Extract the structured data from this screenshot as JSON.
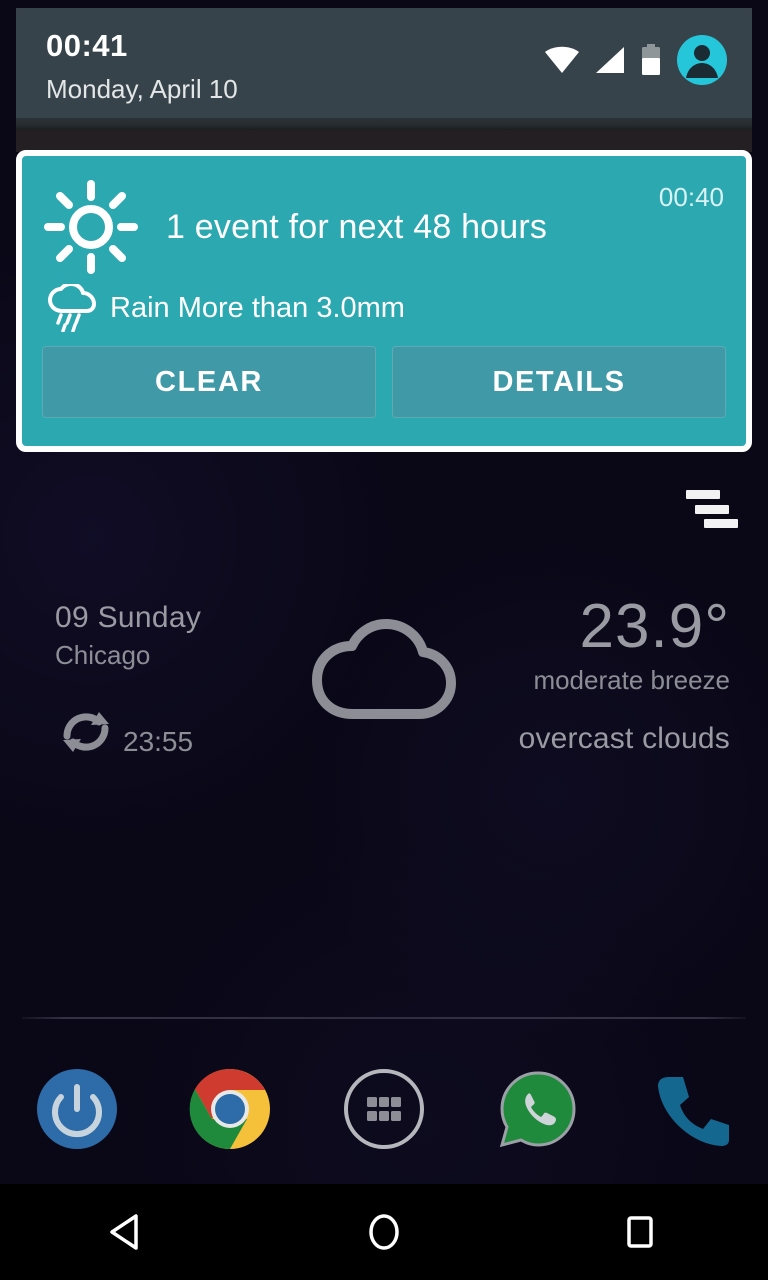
{
  "status_bar": {
    "clock": "00:41",
    "date": "Monday, April 10",
    "icons": [
      {
        "name": "wifi-icon",
        "label": "wifi"
      },
      {
        "name": "cellular-signal-icon",
        "label": "cellular"
      },
      {
        "name": "battery-icon",
        "label": "battery"
      },
      {
        "name": "user-avatar-icon",
        "label": "user"
      }
    ],
    "accent_color": "#26c6da",
    "background_color": "#37434a"
  },
  "notification": {
    "timestamp": "00:40",
    "title": "1 event for next 48 hours",
    "subtitle": "Rain More than 3.0mm",
    "icon": "sun-icon",
    "subtitle_icon": "rain-cloud-icon",
    "card_color": "#2ca8b0",
    "button_color": "#4099a6",
    "actions": [
      {
        "name": "clear-button",
        "label": "CLEAR"
      },
      {
        "name": "details-button",
        "label": "DETAILS"
      }
    ]
  },
  "weather_widget": {
    "menu_icon": "staggered-menu-icon",
    "date": "09 Sunday",
    "city": "Chicago",
    "refresh_icon": "refresh-icon",
    "refresh_time": "23:55",
    "condition_icon": "cloud-icon",
    "temperature": "23.9°",
    "wind": "moderate breeze",
    "condition": "overcast clouds",
    "text_color": "#8d8d96"
  },
  "dock": {
    "items": [
      {
        "name": "power-app-icon",
        "label": "Power"
      },
      {
        "name": "chrome-app-icon",
        "label": "Chrome"
      },
      {
        "name": "app-drawer-icon",
        "label": "Apps"
      },
      {
        "name": "whatsapp-app-icon",
        "label": "WhatsApp"
      },
      {
        "name": "phone-app-icon",
        "label": "Phone"
      }
    ]
  },
  "navbar": {
    "items": [
      {
        "name": "back-button",
        "label": "Back"
      },
      {
        "name": "home-button",
        "label": "Home"
      },
      {
        "name": "recents-button",
        "label": "Recents"
      }
    ]
  }
}
